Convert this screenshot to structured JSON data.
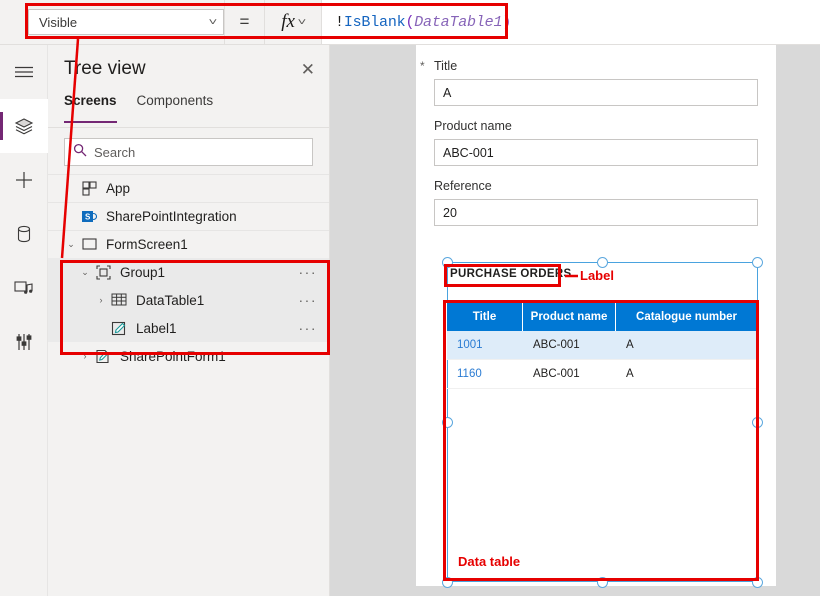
{
  "formula_bar": {
    "property_value": "Visible",
    "equals_label": "=",
    "fx_label": "fx",
    "formula_tokens": [
      {
        "text": "!",
        "kind": "op"
      },
      {
        "text": "IsBlank",
        "kind": "fn"
      },
      {
        "text": "(",
        "kind": "par"
      },
      {
        "text": "DataTable1",
        "kind": "ref"
      },
      {
        "text": ")",
        "kind": "par"
      }
    ],
    "formula_full": "!IsBlank(DataTable1)"
  },
  "rail": {
    "items": [
      {
        "name": "hamburger-menu-icon",
        "label": "Menu"
      },
      {
        "name": "tree-view-icon",
        "label": "Tree view"
      },
      {
        "name": "insert-icon",
        "label": "Insert"
      },
      {
        "name": "data-icon",
        "label": "Data"
      },
      {
        "name": "media-icon",
        "label": "Media"
      },
      {
        "name": "advanced-tools-icon",
        "label": "Advanced tools"
      }
    ]
  },
  "tree_panel": {
    "title": "Tree view",
    "close_label": "✕",
    "tabs": [
      {
        "label": "Screens",
        "active": true
      },
      {
        "label": "Components",
        "active": false
      }
    ],
    "search": {
      "placeholder": "Search",
      "value": ""
    },
    "items": [
      {
        "label": "App",
        "icon": "app-icon",
        "caret": "",
        "indent": 0,
        "highlight": false
      },
      {
        "label": "SharePointIntegration",
        "icon": "sharepoint-icon",
        "caret": "",
        "indent": 0,
        "highlight": false
      },
      {
        "label": "FormScreen1",
        "icon": "screen-icon",
        "caret": "⌄",
        "indent": 0,
        "highlight": false
      },
      {
        "label": "Group1",
        "icon": "group-icon",
        "caret": "⌄",
        "indent": 1,
        "highlight": true,
        "menu": "···"
      },
      {
        "label": "DataTable1",
        "icon": "datatable-icon",
        "caret": "›",
        "indent": 2,
        "highlight": true,
        "menu": "···"
      },
      {
        "label": "Label1",
        "icon": "label-icon",
        "caret": "",
        "indent": 2,
        "highlight": true,
        "menu": "···"
      },
      {
        "label": "SharePointForm1",
        "icon": "form-icon",
        "caret": "›",
        "indent": 1,
        "highlight": false
      }
    ]
  },
  "canvas": {
    "fields": [
      {
        "label": "Title",
        "required": true,
        "value": "A"
      },
      {
        "label": "Product name",
        "required": false,
        "value": "ABC-001"
      },
      {
        "label": "Reference",
        "required": false,
        "value": "20"
      }
    ],
    "section_title": "PURCHASE ORDERS",
    "table": {
      "columns": [
        "Title",
        "Product name",
        "Catalogue number"
      ],
      "rows": [
        [
          "1001",
          "ABC-001",
          "A"
        ],
        [
          "1160",
          "ABC-001",
          "A"
        ]
      ]
    }
  },
  "annotations": {
    "label_callout": "Label",
    "datatable_callout": "Data table"
  },
  "colors": {
    "accent_purple": "#742774",
    "table_header_blue": "#0078d4",
    "table_row_alt": "#deecf9",
    "annotation_red": "#e60000",
    "selection_blue": "#4aa3df"
  }
}
